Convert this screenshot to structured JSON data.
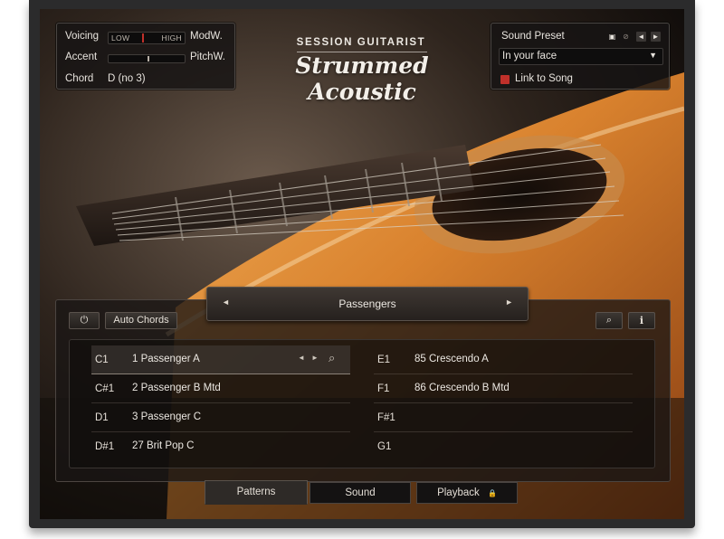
{
  "performance": {
    "voicing_label": "Voicing",
    "voicing_low": "LOW",
    "voicing_high": "HIGH",
    "voicing_level": 0.45,
    "accent_label": "Accent",
    "accent_level": 0.52,
    "modw_label": "ModW.",
    "pitchw_label": "PitchW.",
    "chord_label": "Chord",
    "chord_value": "D (no 3)"
  },
  "product": {
    "subtitle": "SESSION GUITARIST",
    "title": "Strummed Acoustic"
  },
  "preset": {
    "label": "Sound Preset",
    "value": "In your face",
    "link_label": "Link to Song",
    "link_checked": true,
    "save_icon": "save-icon",
    "clear_icon": "clear-icon"
  },
  "pattern_bank": {
    "name": "Passengers",
    "prev": "◄",
    "next": "►"
  },
  "controls": {
    "power_glyph": "⏻",
    "auto_chords_label": "Auto Chords",
    "search_glyph": "⌕",
    "info_glyph": "i"
  },
  "patterns_left": [
    {
      "key": "C1",
      "name": "1 Passenger A"
    },
    {
      "key": "C#1",
      "name": "2 Passenger B Mtd"
    },
    {
      "key": "D1",
      "name": "3 Passenger C"
    },
    {
      "key": "D#1",
      "name": "27 Brit Pop C"
    }
  ],
  "patterns_right": [
    {
      "key": "E1",
      "name": "85 Crescendo A"
    },
    {
      "key": "F1",
      "name": "86 Crescendo B Mtd"
    },
    {
      "key": "F#1",
      "name": ""
    },
    {
      "key": "G1",
      "name": ""
    }
  ],
  "tabs": {
    "patterns": "Patterns",
    "sound": "Sound",
    "playback": "Playback",
    "playback_lock": "🔒"
  },
  "colors": {
    "accent_red": "#c0302a",
    "panel": "#161414"
  }
}
